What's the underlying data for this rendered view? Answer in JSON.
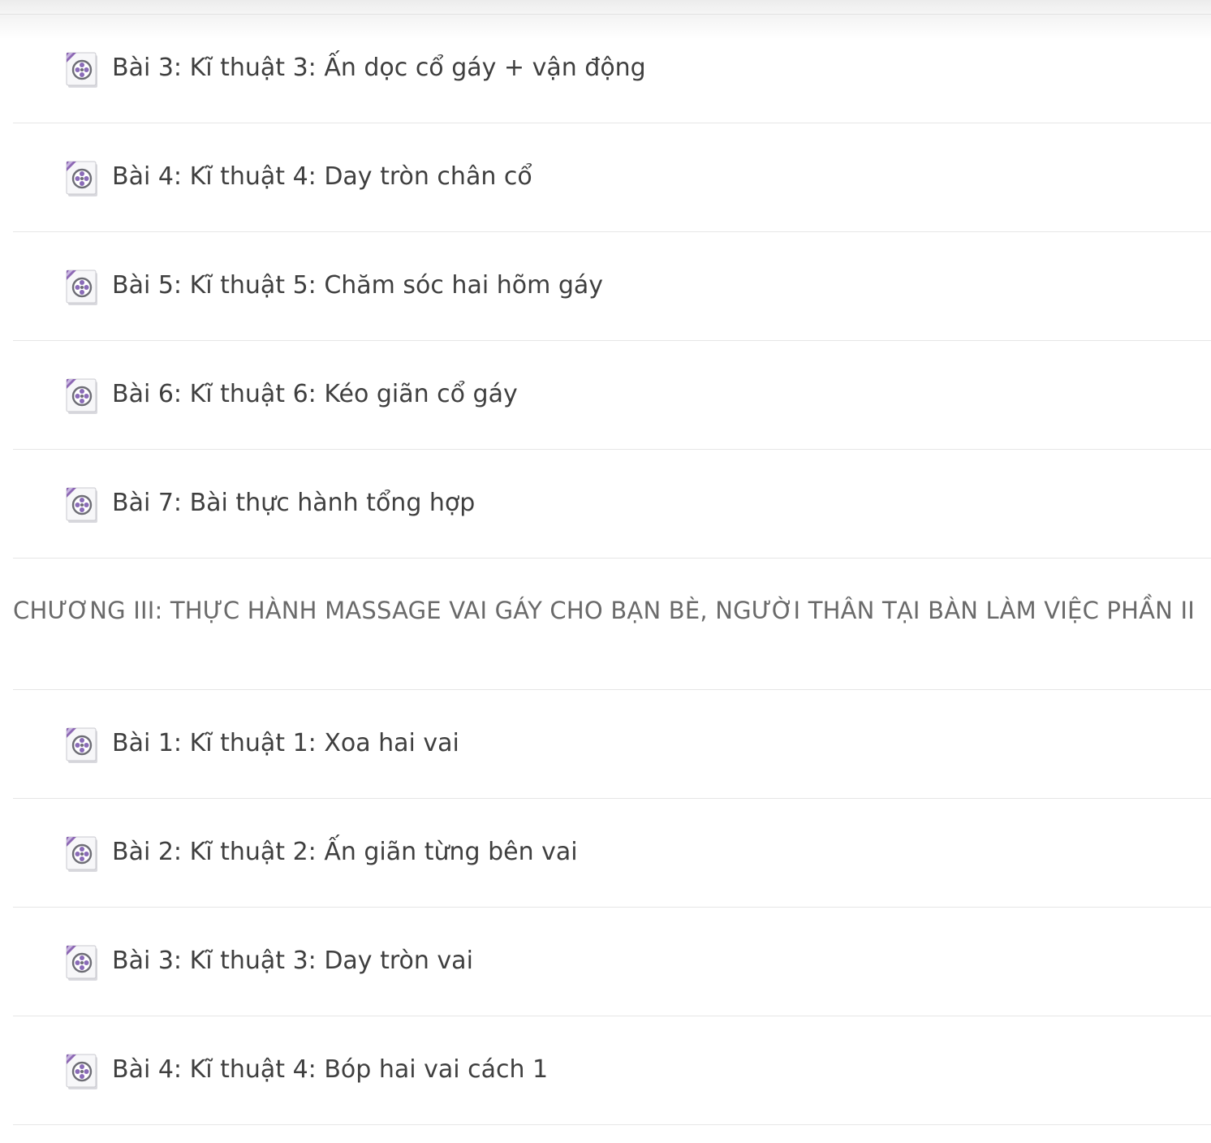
{
  "lessons_top": [
    {
      "label": "Bài 3: Kĩ thuật 3: Ấn dọc cổ gáy + vận động",
      "icon": "video-file-icon"
    },
    {
      "label": "Bài 4: Kĩ thuật 4: Day tròn chân cổ",
      "icon": "video-file-icon"
    },
    {
      "label": "Bài 5: Kĩ thuật 5: Chăm sóc hai hõm gáy",
      "icon": "video-file-icon"
    },
    {
      "label": "Bài 6: Kĩ thuật 6: Kéo giãn cổ gáy",
      "icon": "video-file-icon"
    },
    {
      "label": "Bài 7: Bài thực hành tổng hợp",
      "icon": "video-file-icon"
    }
  ],
  "chapter": {
    "title": "CHƯƠNG III: THỰC HÀNH MASSAGE VAI GÁY CHO BẠN BÈ, NGƯỜI THÂN TẠI BÀN LÀM VIỆC PHẦN II"
  },
  "lessons_bottom": [
    {
      "label": "Bài 1: Kĩ thuật 1: Xoa hai vai",
      "icon": "video-file-icon"
    },
    {
      "label": "Bài 2: Kĩ thuật 2: Ấn giãn từng bên vai",
      "icon": "video-file-icon"
    },
    {
      "label": "Bài 3: Kĩ thuật 3: Day tròn vai",
      "icon": "video-file-icon"
    },
    {
      "label": "Bài 4: Kĩ thuật 4: Bóp hai vai cách 1",
      "icon": "video-file-icon"
    }
  ],
  "colors": {
    "text": "#3f3f3f",
    "chapter_text": "#6a6a6a",
    "divider": "#e6e6e6",
    "icon_accent": "#7a4fa8"
  }
}
